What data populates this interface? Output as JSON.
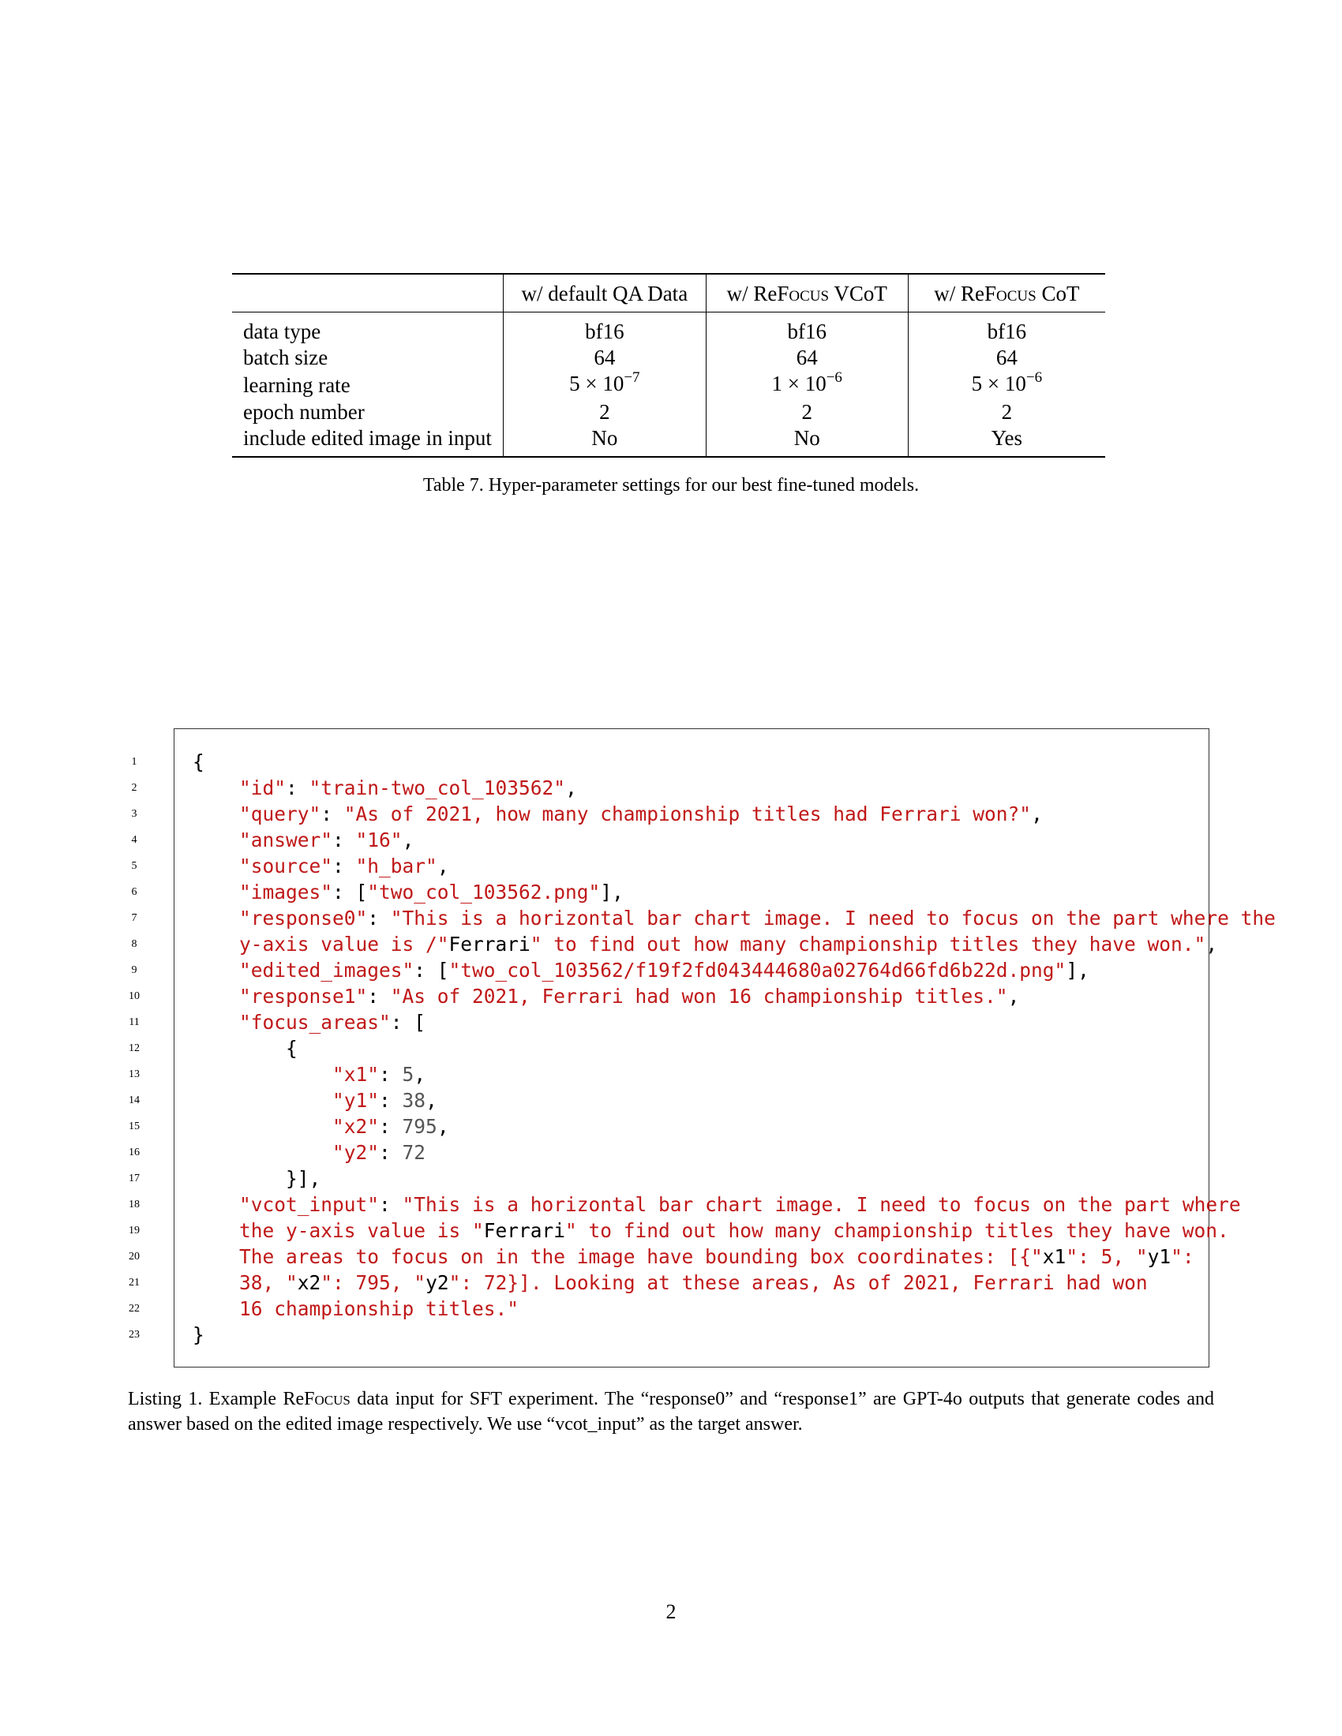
{
  "table": {
    "headers": [
      "",
      "w/ default QA Data",
      "w/ ReFocus VCoT",
      "w/ ReFocus CoT"
    ],
    "header_prefix": "w/",
    "header_brand_parts": [
      "Re",
      "Focus"
    ],
    "header_suffix_vcot": "VCoT",
    "header_suffix_cot": "CoT",
    "rows": [
      {
        "label": "data type",
        "values": [
          "bf16",
          "bf16",
          "bf16"
        ]
      },
      {
        "label": "batch size",
        "values": [
          "64",
          "64",
          "64"
        ]
      },
      {
        "label": "learning rate",
        "values": [
          "5 × 10−7",
          "1 × 10−6",
          "5 × 10−6"
        ],
        "mantissa": [
          "5 × 10",
          "1 × 10",
          "5 × 10"
        ],
        "exponent": [
          "−7",
          "−6",
          "−6"
        ]
      },
      {
        "label": "epoch number",
        "values": [
          "2",
          "2",
          "2"
        ]
      },
      {
        "label": "include edited image in input",
        "values": [
          "No",
          "No",
          "Yes"
        ]
      }
    ],
    "caption": "Table 7. Hyper-parameter settings for our best fine-tuned models."
  },
  "listing": {
    "line_numbers": [
      "1",
      "2",
      "3",
      "4",
      "5",
      "6",
      "7",
      "8",
      "9",
      "10",
      "11",
      "12",
      "13",
      "14",
      "15",
      "16",
      "17",
      "18",
      "19",
      "20",
      "21",
      "22",
      "23"
    ],
    "line_1": "{",
    "line_2_key": "\"id\"",
    "line_2_val": "\"train-two_col_103562\"",
    "line_3_key": "\"query\"",
    "line_3_val": "\"As of 2021, how many championship titles had Ferrari won?\"",
    "line_4_key": "\"answer\"",
    "line_4_val": "\"16\"",
    "line_5_key": "\"source\"",
    "line_5_val": "\"h_bar\"",
    "line_6_key": "\"images\"",
    "line_6_val": "\"two_col_103562.png\"",
    "line_7_key": "\"response0\"",
    "line_7_val": "\"This is a horizontal bar chart image. I need to focus on the part where the",
    "line_8_a": "y-axis value is /\"",
    "line_8_b": "Ferrari",
    "line_8_c": "\" to find out how many championship titles they have won.\"",
    "line_9_key": "\"edited_images\"",
    "line_9_val": "\"two_col_103562/f19f2fd043444680a02764d66fd6b22d.png\"",
    "line_10_key": "\"response1\"",
    "line_10_val": "\"As of 2021, Ferrari had won 16 championship titles.\"",
    "line_11_key": "\"focus_areas\"",
    "line_12": "{",
    "line_13_key": "\"x1\"",
    "line_13_val": "5",
    "line_14_key": "\"y1\"",
    "line_14_val": "38",
    "line_15_key": "\"x2\"",
    "line_15_val": "795",
    "line_16_key": "\"y2\"",
    "line_16_val": "72",
    "line_17": "}],",
    "line_18_key": "\"vcot_input\"",
    "line_18_val": "\"This is a horizontal bar chart image. I need to focus on the part where",
    "line_19_a": "the y-axis value is \"",
    "line_19_b": "Ferrari",
    "line_19_c": "\" to find out how many championship titles they have won.",
    "line_20_a": "The areas to focus on in the image have bounding box coordinates: [{\"",
    "line_20_b": "x1",
    "line_20_c": "\": 5, \"",
    "line_20_d": "y1",
    "line_20_e": "\":",
    "line_21_a": "38, \"",
    "line_21_b": "x2",
    "line_21_c": "\": 795, \"",
    "line_21_d": "y2",
    "line_21_e": "\": 72}]. Looking at these areas, As of 2021, Ferrari had won",
    "line_22": "16 championship titles.\"",
    "line_23": "}"
  },
  "listing_caption": {
    "prefix": "Listing 1. Example ",
    "brand_parts": [
      "Re",
      "Focus"
    ],
    "suffix": " data input for SFT experiment. The “response0” and “response1” are GPT-4o outputs that generate codes and answer based on the edited image respectively. We use “vcot_input” as the target answer."
  },
  "page_number": "2"
}
